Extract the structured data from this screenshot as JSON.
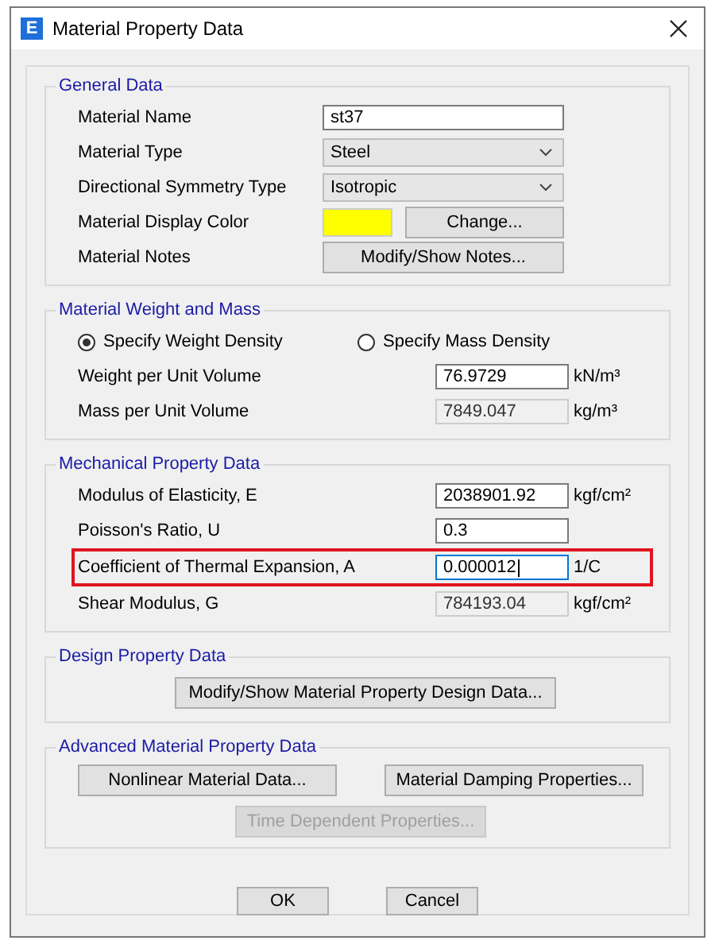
{
  "window": {
    "title": "Material Property Data",
    "icon_letter": "E"
  },
  "general": {
    "title": "General Data",
    "rows": [
      {
        "kind": "input",
        "label": "Material Name",
        "value": "st37"
      },
      {
        "kind": "dropdown",
        "label": "Material Type",
        "value": "Steel"
      },
      {
        "kind": "dropdown",
        "label": "Directional Symmetry Type",
        "value": "Isotropic"
      },
      {
        "kind": "color",
        "label": "Material Display Color",
        "color": "#ffff00",
        "button": "Change..."
      },
      {
        "kind": "button",
        "label": "Material Notes",
        "button": "Modify/Show Notes..."
      }
    ]
  },
  "weight": {
    "title": "Material Weight and Mass",
    "options": [
      {
        "label": "Specify Weight Density",
        "selected": true
      },
      {
        "label": "Specify Mass Density",
        "selected": false
      }
    ],
    "rows": [
      {
        "label": "Weight per Unit Volume",
        "value": "76.9729",
        "unit": "kN/m³",
        "disabled": false,
        "focused": false,
        "highlighted": false
      },
      {
        "label": "Mass per Unit Volume",
        "value": "7849.047",
        "unit": "kg/m³",
        "disabled": true,
        "focused": false,
        "highlighted": false
      }
    ]
  },
  "mechanical": {
    "title": "Mechanical Property Data",
    "rows": [
      {
        "label": "Modulus of Elasticity,  E",
        "value": "2038901.92",
        "unit": "kgf/cm²",
        "disabled": false,
        "focused": false,
        "highlighted": false
      },
      {
        "label": "Poisson's Ratio,  U",
        "value": "0.3",
        "disabled": false,
        "focused": false,
        "highlighted": false
      },
      {
        "label": "Coefficient of Thermal Expansion,  A",
        "value": "0.000012",
        "unit": "1/C",
        "disabled": false,
        "focused": true,
        "highlighted": true
      },
      {
        "label": "Shear Modulus,  G",
        "value": "784193.04",
        "unit": "kgf/cm²",
        "disabled": true,
        "focused": false,
        "highlighted": false
      }
    ]
  },
  "design": {
    "title": "Design Property Data",
    "buttons": [
      {
        "label": "Modify/Show Material Property Design Data...",
        "disabled": false
      }
    ]
  },
  "advanced": {
    "title": "Advanced Material Property Data",
    "buttons": [
      {
        "label": "Nonlinear Material Data...",
        "disabled": false
      },
      {
        "label": "Material Damping Properties...",
        "disabled": false
      },
      {
        "label": "Time Dependent Properties...",
        "disabled": true
      }
    ]
  },
  "buttons": [
    "OK",
    "Cancel"
  ]
}
